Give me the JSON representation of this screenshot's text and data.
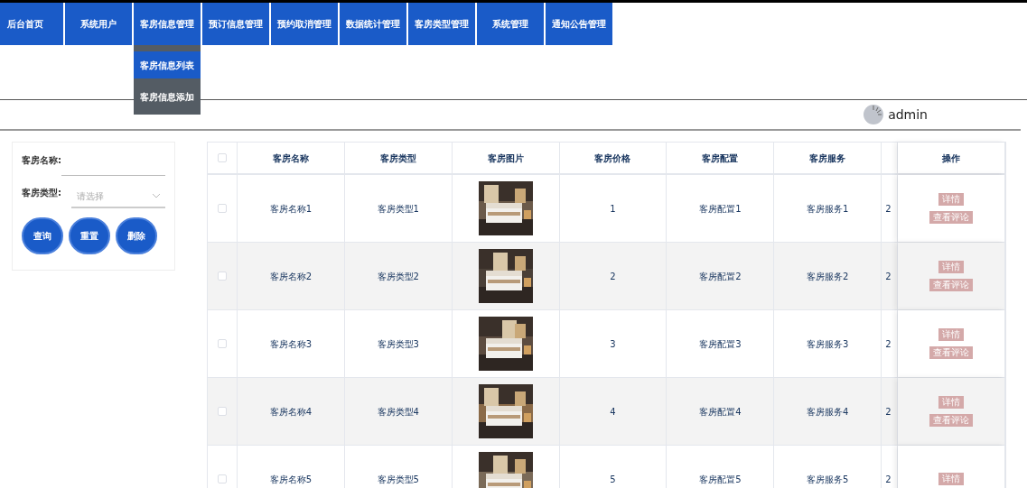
{
  "nav": [
    {
      "label": "后台首页"
    },
    {
      "label": "系统用户"
    },
    {
      "label": "客房信息管理",
      "expanded": true
    },
    {
      "label": "预订信息管理"
    },
    {
      "label": "预约取消管理"
    },
    {
      "label": "数据统计管理"
    },
    {
      "label": "客房类型管理"
    },
    {
      "label": "系统管理"
    },
    {
      "label": "通知公告管理"
    }
  ],
  "dropdown": [
    {
      "label": "客房信息列表",
      "selected": true
    },
    {
      "label": "客房信息添加",
      "selected": false
    }
  ],
  "user": {
    "name": "admin"
  },
  "search": {
    "fields": [
      {
        "kind": "text",
        "label": "客房名称:"
      },
      {
        "kind": "select",
        "label": "客房类型:",
        "placeholder": "请选择"
      }
    ],
    "buttons": [
      "查询",
      "重置",
      "删除"
    ]
  },
  "table": {
    "header_checked": false,
    "columns": [
      "客房名称",
      "客房类型",
      "客房图片",
      "客房价格",
      "客房配置",
      "客房服务"
    ],
    "action_column": "操作",
    "rows": [
      {
        "checked": false,
        "name": "客房名称1",
        "type": "客房类型1",
        "price": "1",
        "config": "客房配置1",
        "service": "客房服务1",
        "column_8": "2",
        "actions": [
          "详情",
          "查看评论"
        ]
      },
      {
        "checked": false,
        "name": "客房名称2",
        "type": "客房类型2",
        "price": "2",
        "config": "客房配置2",
        "service": "客房服务2",
        "column_8": "2",
        "actions": [
          "详情",
          "查看评论"
        ]
      },
      {
        "checked": false,
        "name": "客房名称3",
        "type": "客房类型3",
        "price": "3",
        "config": "客房配置3",
        "service": "客房服务3",
        "column_8": "2",
        "actions": [
          "详情",
          "查看评论"
        ]
      },
      {
        "checked": false,
        "name": "客房名称4",
        "type": "客房类型4",
        "price": "4",
        "config": "客房配置4",
        "service": "客房服务4",
        "column_8": "2",
        "actions": [
          "详情",
          "查看评论"
        ]
      },
      {
        "checked": false,
        "name": "客房名称5",
        "type": "客房类型5",
        "price": "5",
        "config": "客房配置5",
        "service": "客房服务5",
        "column_8": "2",
        "actions": [
          "详情"
        ]
      }
    ]
  }
}
